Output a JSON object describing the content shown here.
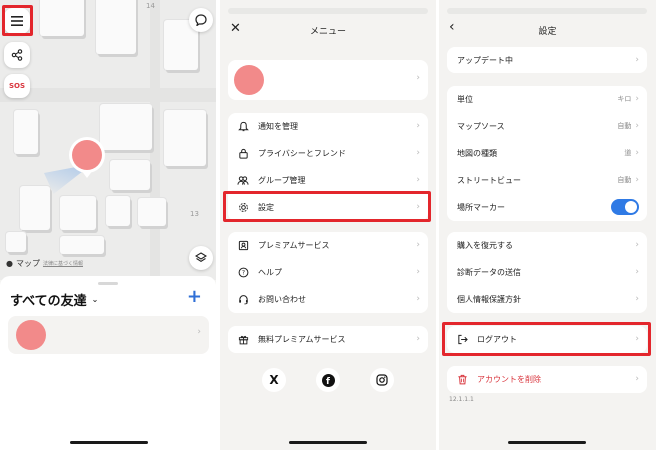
{
  "map": {
    "block_numbers": [
      "14",
      "13"
    ],
    "credit_brand": "マップ",
    "credit_legal": "法律に基づく情報"
  },
  "buttons": {
    "sos_label": "SOS"
  },
  "friends_sheet": {
    "title": "すべての友達",
    "add_label": "+"
  },
  "menu": {
    "title": "メニュー",
    "group1": [
      {
        "label": "通知を管理",
        "icon": "bell-icon"
      },
      {
        "label": "プライバシーとフレンド",
        "icon": "lock-icon"
      },
      {
        "label": "グループ管理",
        "icon": "group-icon"
      },
      {
        "label": "設定",
        "icon": "gear-icon"
      }
    ],
    "group2": [
      {
        "label": "プレミアムサービス",
        "icon": "premium-icon"
      },
      {
        "label": "ヘルプ",
        "icon": "help-icon"
      },
      {
        "label": "お問い合わせ",
        "icon": "headset-icon"
      }
    ],
    "group3": [
      {
        "label": "無料プレミアムサービス",
        "icon": "gift-icon"
      }
    ],
    "social": [
      "X",
      "f",
      "ig"
    ]
  },
  "settings": {
    "title": "設定",
    "update": {
      "label": "アップデート中"
    },
    "group1": [
      {
        "label": "単位",
        "value": "キロ"
      },
      {
        "label": "マップソース",
        "value": "自動"
      },
      {
        "label": "地図の種類",
        "value": "道"
      },
      {
        "label": "ストリートビュー",
        "value": "自動"
      },
      {
        "label": "場所マーカー",
        "toggle": true
      }
    ],
    "group2": [
      {
        "label": "購入を復元する"
      },
      {
        "label": "診断データの送信"
      },
      {
        "label": "個人情報保護方針"
      }
    ],
    "logout": "ログアウト",
    "delete_account": "アカウントを削除",
    "version": "12.1.1.1"
  },
  "colors": {
    "highlight": "#e3262c",
    "accent": "#2f7ae5",
    "avatar": "#f28a8a",
    "danger": "#d9363e"
  }
}
